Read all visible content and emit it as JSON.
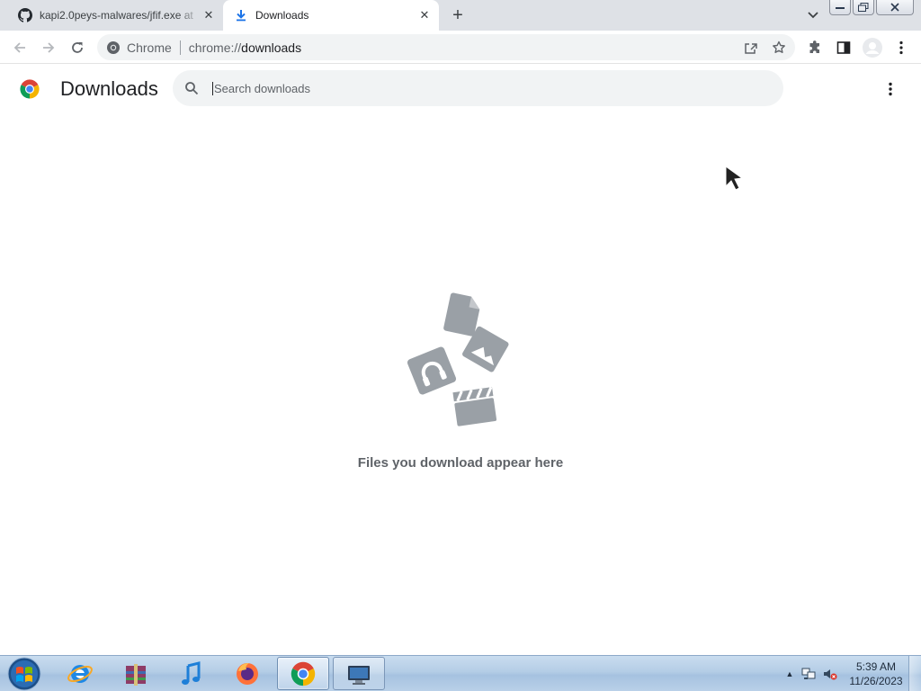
{
  "tabs": [
    {
      "title": "kapi2.0peys-malwares/jfif.exe at",
      "icon": "github-icon",
      "close": "✕"
    },
    {
      "title": "Downloads",
      "icon": "download-icon",
      "close": "✕"
    }
  ],
  "new_tab_label": "+",
  "omnibox": {
    "site_chip": "Chrome",
    "url_scheme": "chrome://",
    "url_host": "downloads"
  },
  "page": {
    "title": "Downloads",
    "search_placeholder": "Search downloads",
    "empty_message": "Files you download appear here"
  },
  "taskbar": {
    "apps": [
      "internet-explorer",
      "winrar",
      "itunes",
      "firefox",
      "chrome",
      "remote-desktop"
    ],
    "clock_time": "5:39 AM",
    "clock_date": "11/26/2023"
  },
  "colors": {
    "tabstrip_bg": "#dee1e6",
    "omnibox_bg": "#f1f3f4",
    "illustration_gray": "#9aa0a6",
    "chrome_red": "#db4437",
    "chrome_yellow": "#f4b400",
    "chrome_green": "#0f9d58",
    "chrome_blue": "#4285f4"
  }
}
